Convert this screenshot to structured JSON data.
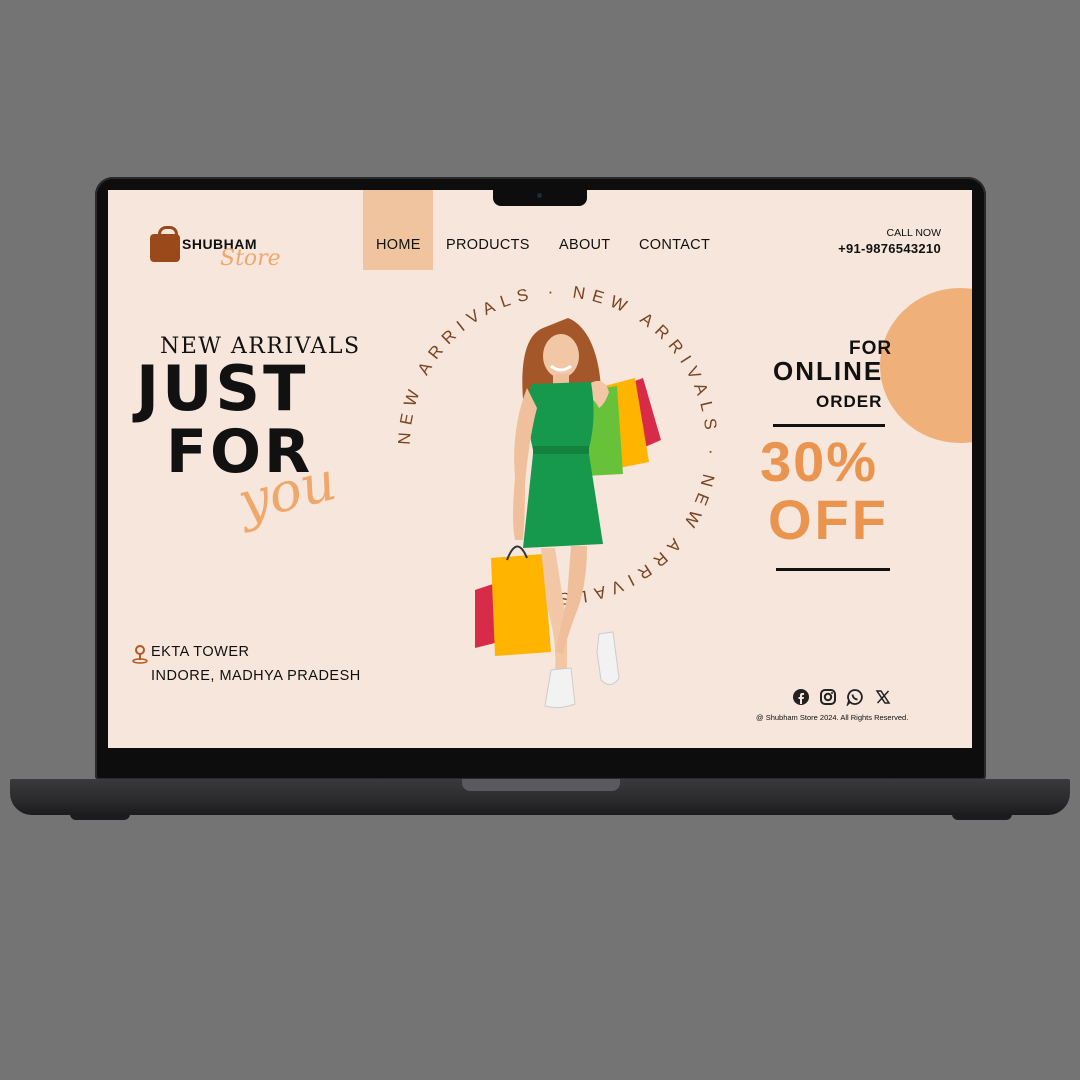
{
  "brand": {
    "name": "SHUBHAM",
    "sub": "Store"
  },
  "nav": {
    "items": [
      {
        "label": "HOME",
        "active": true
      },
      {
        "label": "PRODUCTS"
      },
      {
        "label": "ABOUT"
      },
      {
        "label": "CONTACT"
      }
    ]
  },
  "contact": {
    "label": "CALL NOW",
    "phone": "+91-9876543210"
  },
  "hero": {
    "eyebrow": "NEW ARRIVALS",
    "line1": "JUST",
    "line2": "FOR",
    "script": "you",
    "ring_text": "NEW ARRIVALS · NEW ARRIVALS · NEW ARRIVALS · "
  },
  "address": {
    "line1": "EKTA TOWER",
    "line2": "INDORE, MADHYA PRADESH"
  },
  "offer": {
    "for": "FOR",
    "online": "ONLINE",
    "order": "ORDER",
    "percent": "30%",
    "off": "OFF"
  },
  "social": {
    "icons": [
      "facebook-icon",
      "instagram-icon",
      "whatsapp-icon",
      "x-icon"
    ]
  },
  "footer": {
    "copyright": "@ Shubham Store 2024. All Rights Reserved."
  },
  "colors": {
    "accent": "#e9954f",
    "peach": "#f0c49e",
    "background": "#f6e6dc",
    "brand_brown": "#9a4a1a"
  }
}
